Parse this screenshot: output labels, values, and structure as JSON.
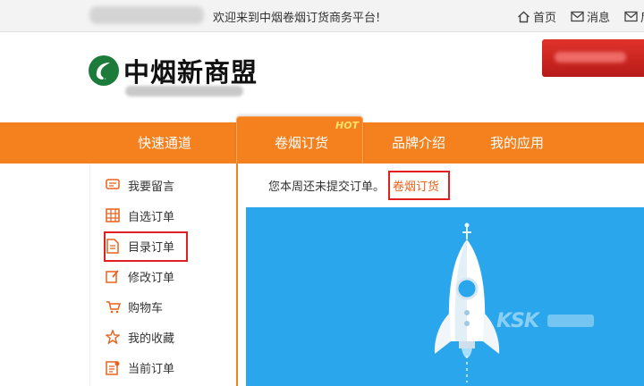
{
  "topbar": {
    "welcome_text": "欢迎来到中烟卷烟订货商务平台!",
    "links": [
      {
        "label": "首页",
        "icon": "home-icon"
      },
      {
        "label": "消息",
        "icon": "mail-icon"
      },
      {
        "label": "后",
        "icon": "mail-icon"
      }
    ]
  },
  "header": {
    "logo_text": "中烟新商盟"
  },
  "nav": {
    "items": [
      "快速通道",
      "卷烟订货",
      "品牌介绍",
      "我的应用"
    ],
    "active_badge": "HOT"
  },
  "sidebar": {
    "items": [
      {
        "label": "我要留言",
        "icon": "message-icon"
      },
      {
        "label": "自选订单",
        "icon": "grid-icon"
      },
      {
        "label": "目录订单",
        "icon": "document-icon"
      },
      {
        "label": "修改订单",
        "icon": "edit-icon"
      },
      {
        "label": "购物车",
        "icon": "cart-icon"
      },
      {
        "label": "我的收藏",
        "icon": "star-icon"
      },
      {
        "label": "当前订单",
        "icon": "order-icon"
      }
    ]
  },
  "main": {
    "notice_text": "您本周还未提交订单。",
    "notice_link": "卷烟订货",
    "watermark": "KSK"
  },
  "colors": {
    "accent": "#f5801e",
    "hero_blue": "#2aa7ec",
    "highlight_red": "#e02020",
    "link_orange": "#e8621b"
  }
}
